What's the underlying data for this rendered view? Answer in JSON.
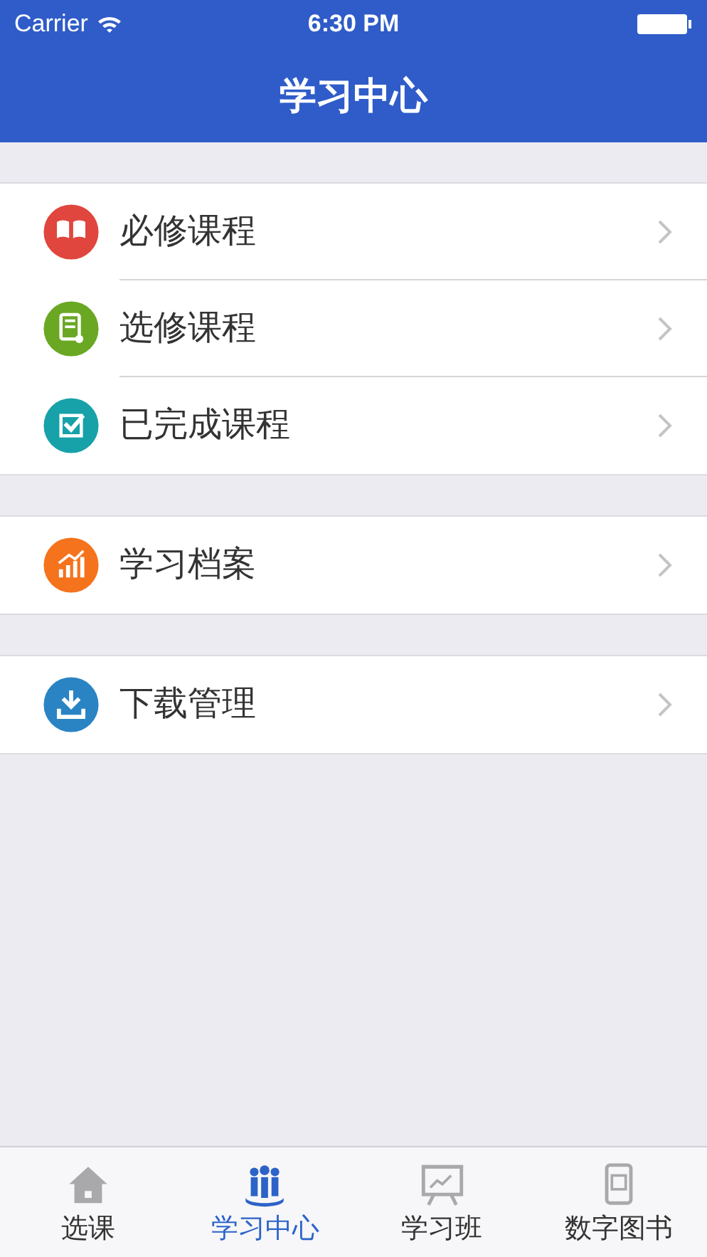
{
  "status_bar": {
    "carrier": "Carrier",
    "time": "6:30 PM"
  },
  "nav_bar": {
    "title": "学习中心"
  },
  "groups": [
    {
      "items": [
        {
          "label": "必修课程",
          "color": "#e0463e"
        },
        {
          "label": "选修课程",
          "color": "#6aa823"
        },
        {
          "label": "已完成课程",
          "color": "#17a1a8"
        }
      ]
    },
    {
      "items": [
        {
          "label": "学习档案",
          "color": "#f4731c"
        }
      ]
    },
    {
      "items": [
        {
          "label": "下载管理",
          "color": "#2a84c4"
        }
      ]
    }
  ],
  "tab_bar": [
    {
      "label": "选课",
      "selected": false
    },
    {
      "label": "学习中心",
      "selected": true
    },
    {
      "label": "学习班",
      "selected": false
    },
    {
      "label": "数字图书",
      "selected": false
    }
  ]
}
